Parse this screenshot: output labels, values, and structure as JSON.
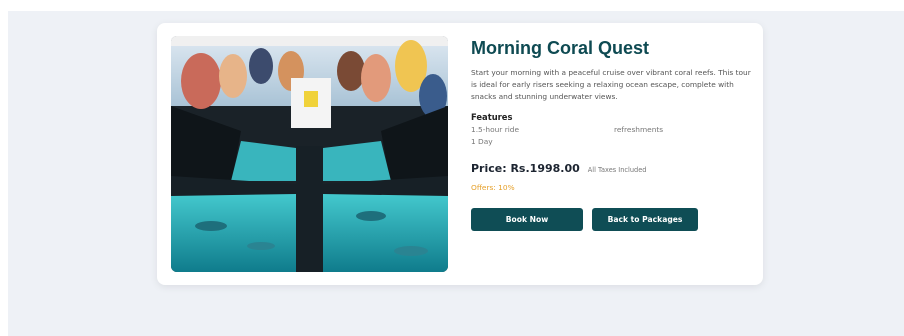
{
  "package": {
    "title": "Morning Coral Quest",
    "description": "Start your morning with a peaceful cruise over vibrant coral reefs. This tour is ideal for early risers seeking a relaxing ocean escape, complete with snacks and stunning underwater views.",
    "features_heading": "Features",
    "features": [
      "1.5-hour ride",
      "refreshments",
      "1 Day"
    ],
    "price": "Price: Rs.1998.00",
    "tax_note": "All Taxes Included",
    "offers": "Offers: 10%"
  },
  "actions": {
    "book_label": "Book Now",
    "back_label": "Back to Packages"
  },
  "colors": {
    "accent": "#0f4d55",
    "title": "#0e4a52",
    "offers": "#e6a12b",
    "page_background": "#eef1f6"
  }
}
